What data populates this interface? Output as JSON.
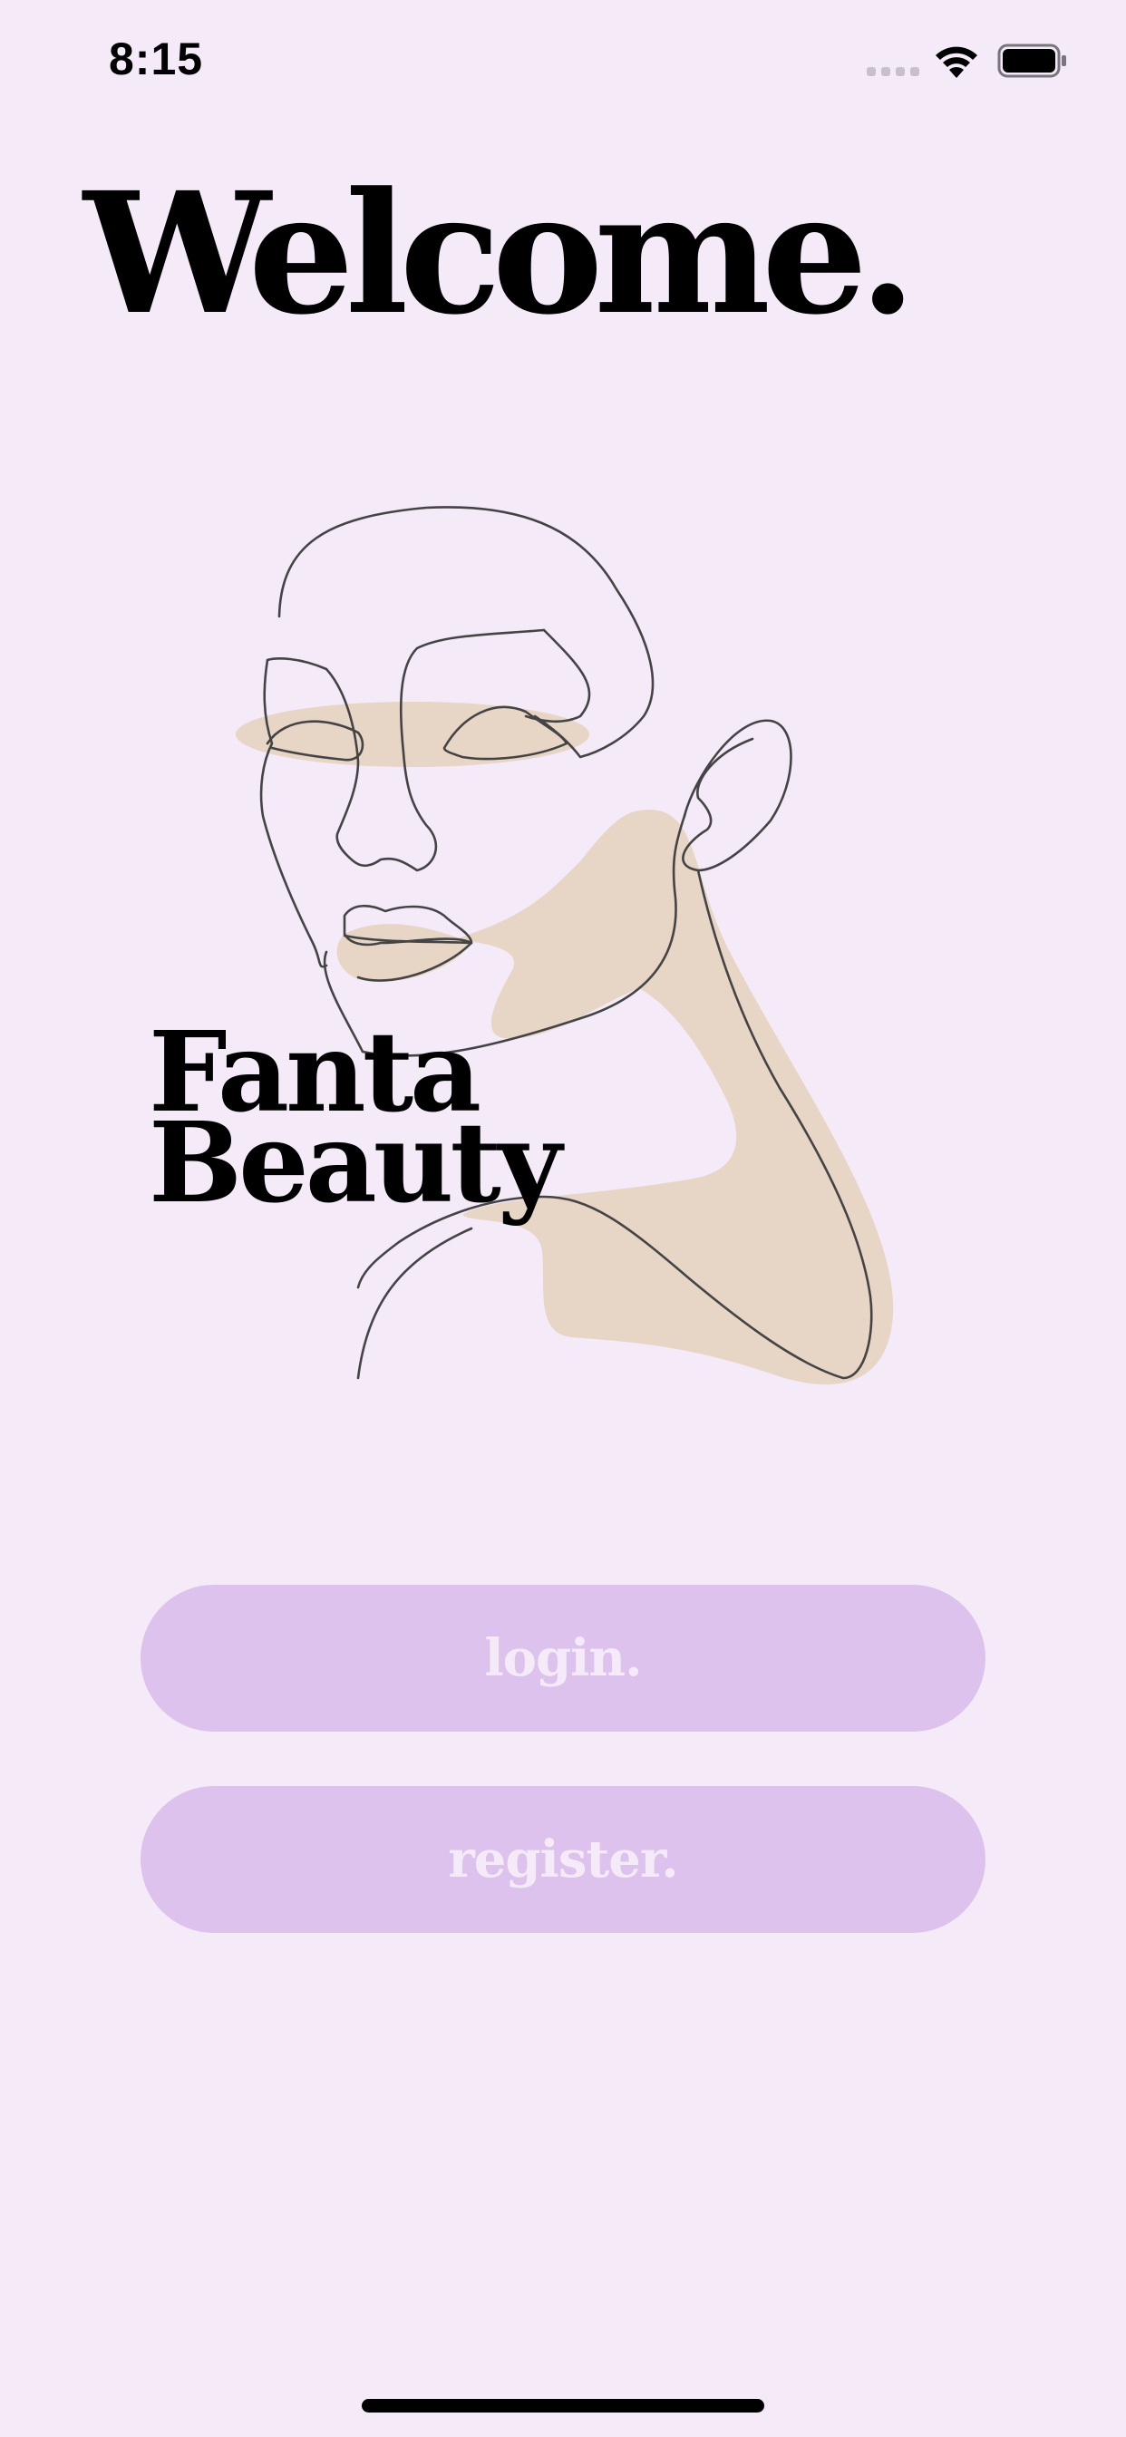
{
  "status_bar": {
    "time": "8:15"
  },
  "screen": {
    "title": "Welcome.",
    "brand": {
      "line1": "Fanta",
      "line2": "Beauty"
    },
    "illustration": "line-art-face-icon"
  },
  "buttons": {
    "login_label": "login.",
    "register_label": "register."
  },
  "colors": {
    "background": "#f4eaf8",
    "button": "#dcc2ec",
    "button_text": "#f4eaf8",
    "accent_skin": "#e7d5c6",
    "text": "#000000"
  }
}
